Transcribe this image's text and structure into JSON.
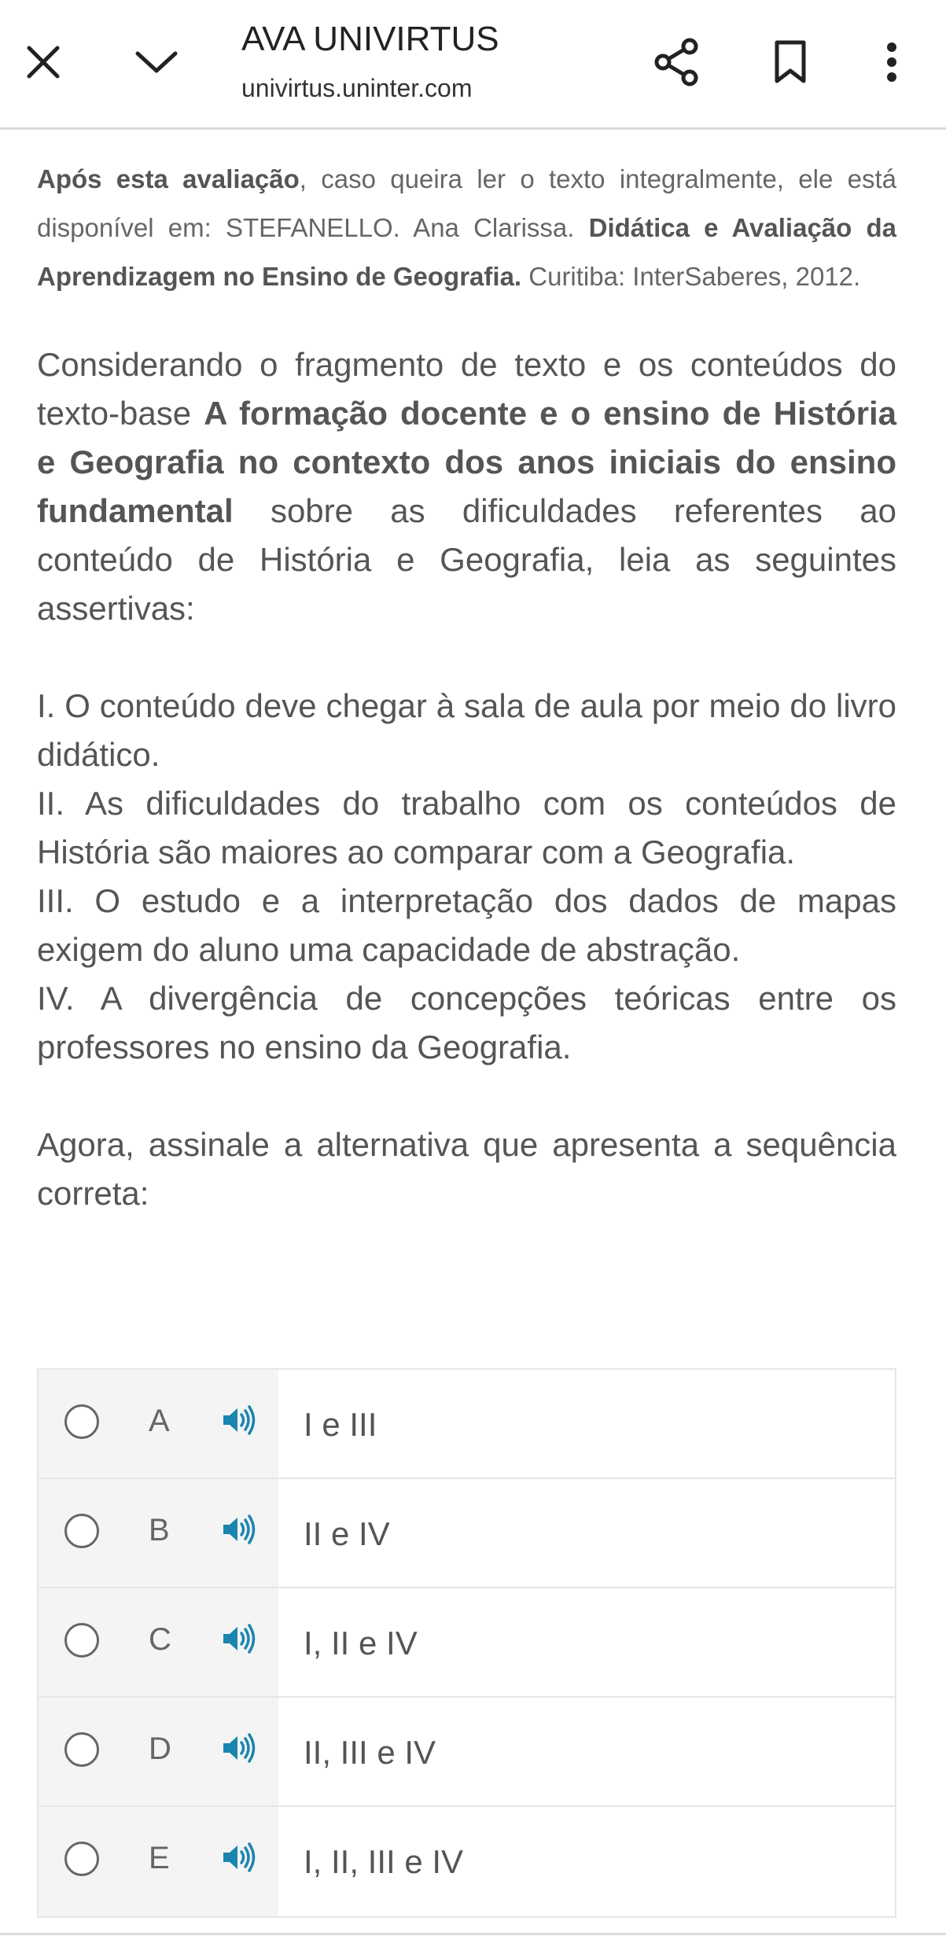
{
  "browser": {
    "title": "AVA UNIVIRTUS",
    "url": "univirtus.uninter.com",
    "icons": [
      "close-icon",
      "chevron-down-icon",
      "share-icon",
      "bookmark-icon",
      "more-vert-icon"
    ]
  },
  "citation": {
    "bold_lead": "Após esta avaliação",
    "text1": ", caso queira ler o texto integralmente, ele está disponível em: STEFANELLO. Ana Clarissa. ",
    "bold_title": "Didática e Avaliação da Aprendizagem no Ensino de Geografia.",
    "text2": " Curitiba: InterSaberes, 2012."
  },
  "question": {
    "intro1": "Considerando o fragmento de texto e os conteúdos do texto-base ",
    "intro_bold": "A formação docente e o ensino de História e Geografia no contexto dos anos iniciais do ensino fundamental",
    "intro2": " sobre as dificuldades referentes ao conteúdo de História e Geografia, leia as seguintes assertivas:",
    "assertions": [
      "I. O conteúdo deve chegar à sala de aula por meio do livro didático.",
      "II. As dificuldades do trabalho com os conteúdos de História são maiores ao comparar com a Geografia.",
      "III. O estudo e a interpretação dos dados de mapas exigem do aluno uma capacidade de abstração.",
      "IV. A divergência de concepções teóricas entre os professores no ensino da Geografia."
    ],
    "prompt": "Agora, assinale a alternativa que apresenta a sequência correta:"
  },
  "options": [
    {
      "letter": "A",
      "text": "I e III"
    },
    {
      "letter": "B",
      "text": "II e IV"
    },
    {
      "letter": "C",
      "text": "I, II e IV"
    },
    {
      "letter": "D",
      "text": "II, III e IV"
    },
    {
      "letter": "E",
      "text": "I, II, III e IV"
    }
  ],
  "colors": {
    "speaker": "#1a85b0",
    "text": "#555555",
    "option_bg": "#f4f4f4"
  }
}
